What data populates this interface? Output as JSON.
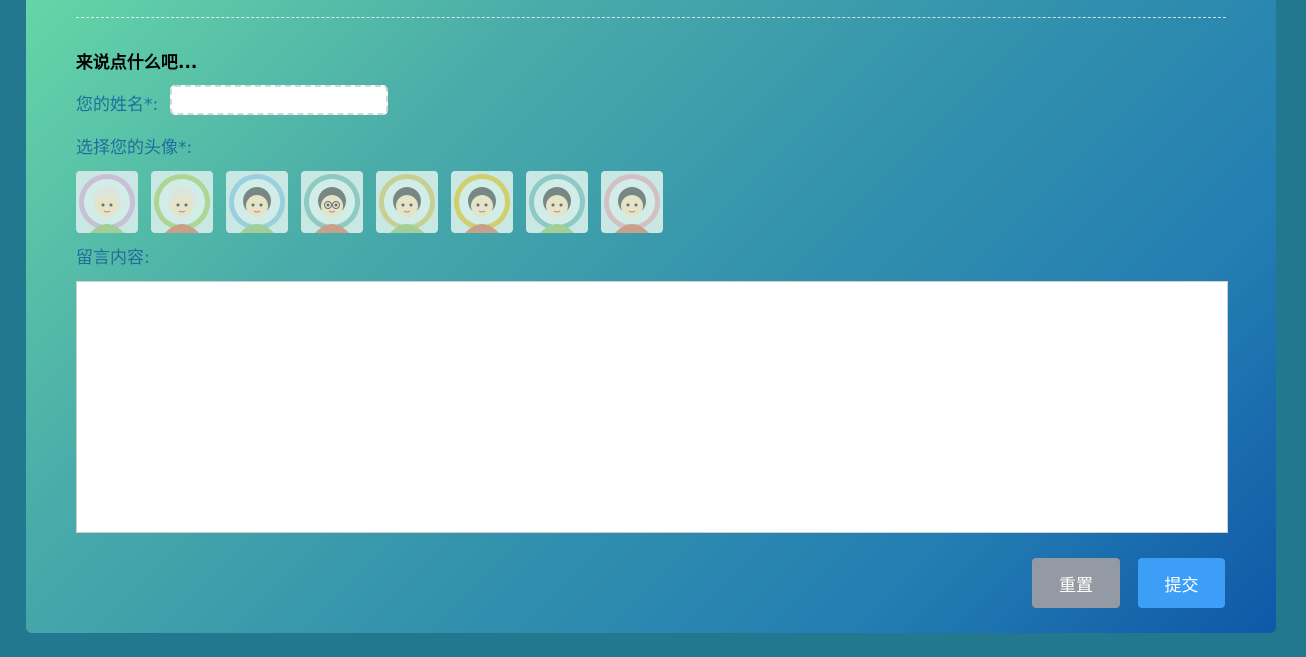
{
  "form": {
    "heading": "来说点什么吧...",
    "name_label": "您的姓名*:",
    "name_value": "",
    "avatar_label": "选择您的头像*:",
    "message_label": "留言内容:",
    "message_value": "",
    "reset_label": "重置",
    "submit_label": "提交"
  },
  "avatars": [
    {
      "name": "avatar-1",
      "ring": "#c7a9cf",
      "face": "#f4e0b8"
    },
    {
      "name": "avatar-2",
      "ring": "#9ecb67",
      "face": "#f4e0b8"
    },
    {
      "name": "avatar-3",
      "ring": "#7fc4d9",
      "face": "#f4e0b8"
    },
    {
      "name": "avatar-4",
      "ring": "#6fb7b0",
      "face": "#f4e0b8"
    },
    {
      "name": "avatar-5",
      "ring": "#c8c06a",
      "face": "#f4e0b8"
    },
    {
      "name": "avatar-6",
      "ring": "#d4c12a",
      "face": "#f4e0b8"
    },
    {
      "name": "avatar-7",
      "ring": "#6db7b5",
      "face": "#f4e0b8"
    },
    {
      "name": "avatar-8",
      "ring": "#d7a9b4",
      "face": "#f4e0b8"
    }
  ],
  "colors": {
    "label_text": "#1f6f9a",
    "reset_button": "#949aa3",
    "submit_button": "#3c9ef7"
  }
}
